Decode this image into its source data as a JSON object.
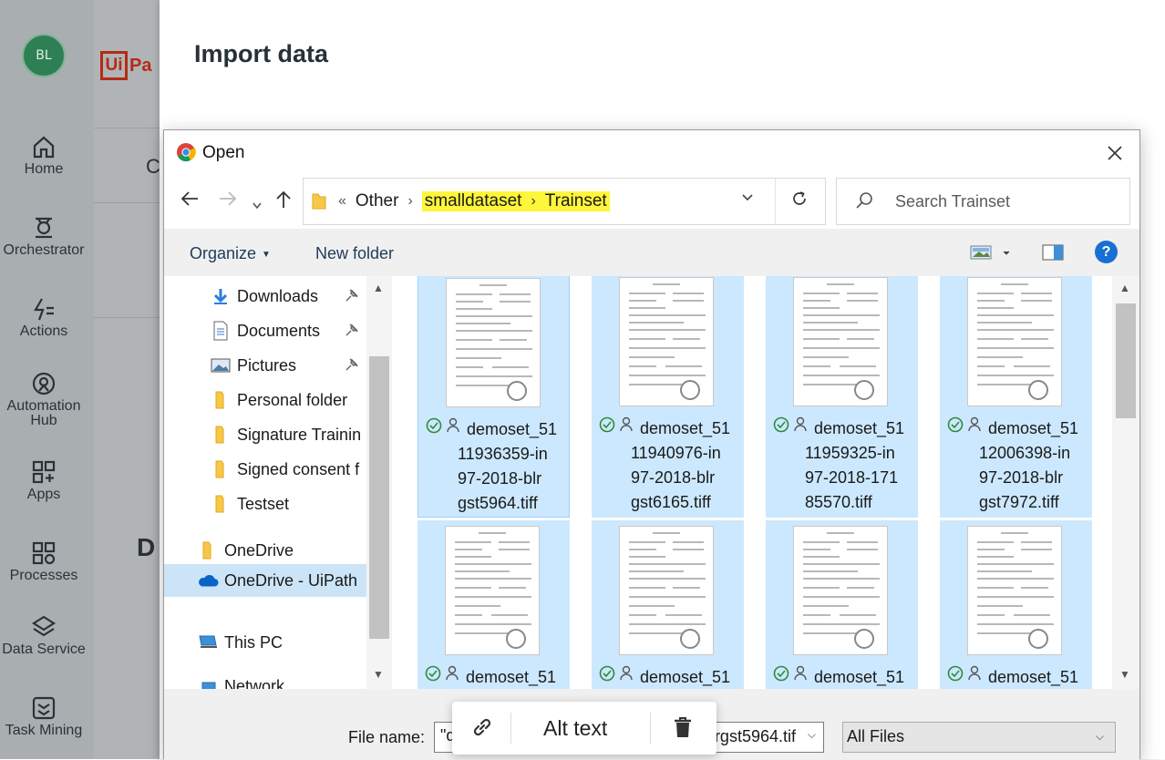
{
  "sidebar": {
    "avatar_initials": "BL",
    "items": [
      {
        "label": "Home",
        "icon": "home-icon"
      },
      {
        "label": "Orchestrator",
        "icon": "orchestrator-icon"
      },
      {
        "label": "Actions",
        "icon": "actions-icon"
      },
      {
        "label": "Automation Hub",
        "icon": "automation-hub-icon"
      },
      {
        "label": "Apps",
        "icon": "apps-icon"
      },
      {
        "label": "Processes",
        "icon": "processes-icon"
      },
      {
        "label": "Data Service",
        "icon": "data-service-icon"
      },
      {
        "label": "Task Mining",
        "icon": "task-mining-icon"
      }
    ]
  },
  "app": {
    "logo_box": "Ui",
    "logo_text": "Pa",
    "strip_letter_1": "C",
    "strip_letter_2": "D"
  },
  "import_panel": {
    "title": "Import data"
  },
  "dialog": {
    "title": "Open",
    "breadcrumb": {
      "overflow": "«",
      "items": [
        "Other",
        "smalldataset",
        "Trainset"
      ]
    },
    "search_placeholder": "Search Trainset",
    "toolbar": {
      "organize": "Organize",
      "new_folder": "New folder"
    },
    "nav_items": [
      {
        "label": "Downloads",
        "icon": "download-icon",
        "pinned": true
      },
      {
        "label": "Documents",
        "icon": "documents-icon",
        "pinned": true
      },
      {
        "label": "Pictures",
        "icon": "pictures-icon",
        "pinned": true
      },
      {
        "label": "Personal folder",
        "icon": "folder-icon"
      },
      {
        "label": "Signature Trainin",
        "icon": "folder-icon"
      },
      {
        "label": "Signed consent f",
        "icon": "folder-icon"
      },
      {
        "label": "Testset",
        "icon": "folder-icon"
      },
      {
        "label": "OneDrive",
        "icon": "folder-icon"
      },
      {
        "label": "OneDrive - UiPath",
        "icon": "cloud-icon",
        "selected": true
      },
      {
        "label": "This PC",
        "icon": "computer-icon"
      },
      {
        "label": "Network",
        "icon": "network-icon"
      }
    ],
    "files": [
      {
        "name_lines": [
          "demoset_51",
          "11936359-in",
          "97-2018-blr",
          "gst5964.tiff"
        ]
      },
      {
        "name_lines": [
          "demoset_51",
          "11940976-in",
          "97-2018-blr",
          "gst6165.tiff"
        ]
      },
      {
        "name_lines": [
          "demoset_51",
          "11959325-in",
          "97-2018-171",
          "85570.tiff"
        ]
      },
      {
        "name_lines": [
          "demoset_51",
          "12006398-in",
          "97-2018-blr",
          "gst7972.tiff"
        ]
      },
      {
        "name_lines": [
          "demoset_51",
          "",
          "",
          ""
        ]
      },
      {
        "name_lines": [
          "demoset_51",
          "",
          "",
          ""
        ]
      },
      {
        "name_lines": [
          "demoset_51",
          "",
          "",
          ""
        ]
      },
      {
        "name_lines": [
          "demoset_51",
          "",
          "",
          ""
        ]
      }
    ],
    "file_name_label": "File name:",
    "file_name_value_start": "\"d",
    "file_name_value_end": "rgst5964.tif",
    "file_type": "All Files"
  },
  "image_toolbar": {
    "alt_text": "Alt text"
  },
  "colors": {
    "selection": "#cce8ff",
    "highlight": "#fdf63a",
    "brand_red": "#b22c14",
    "help_blue": "#1a6fd3"
  }
}
